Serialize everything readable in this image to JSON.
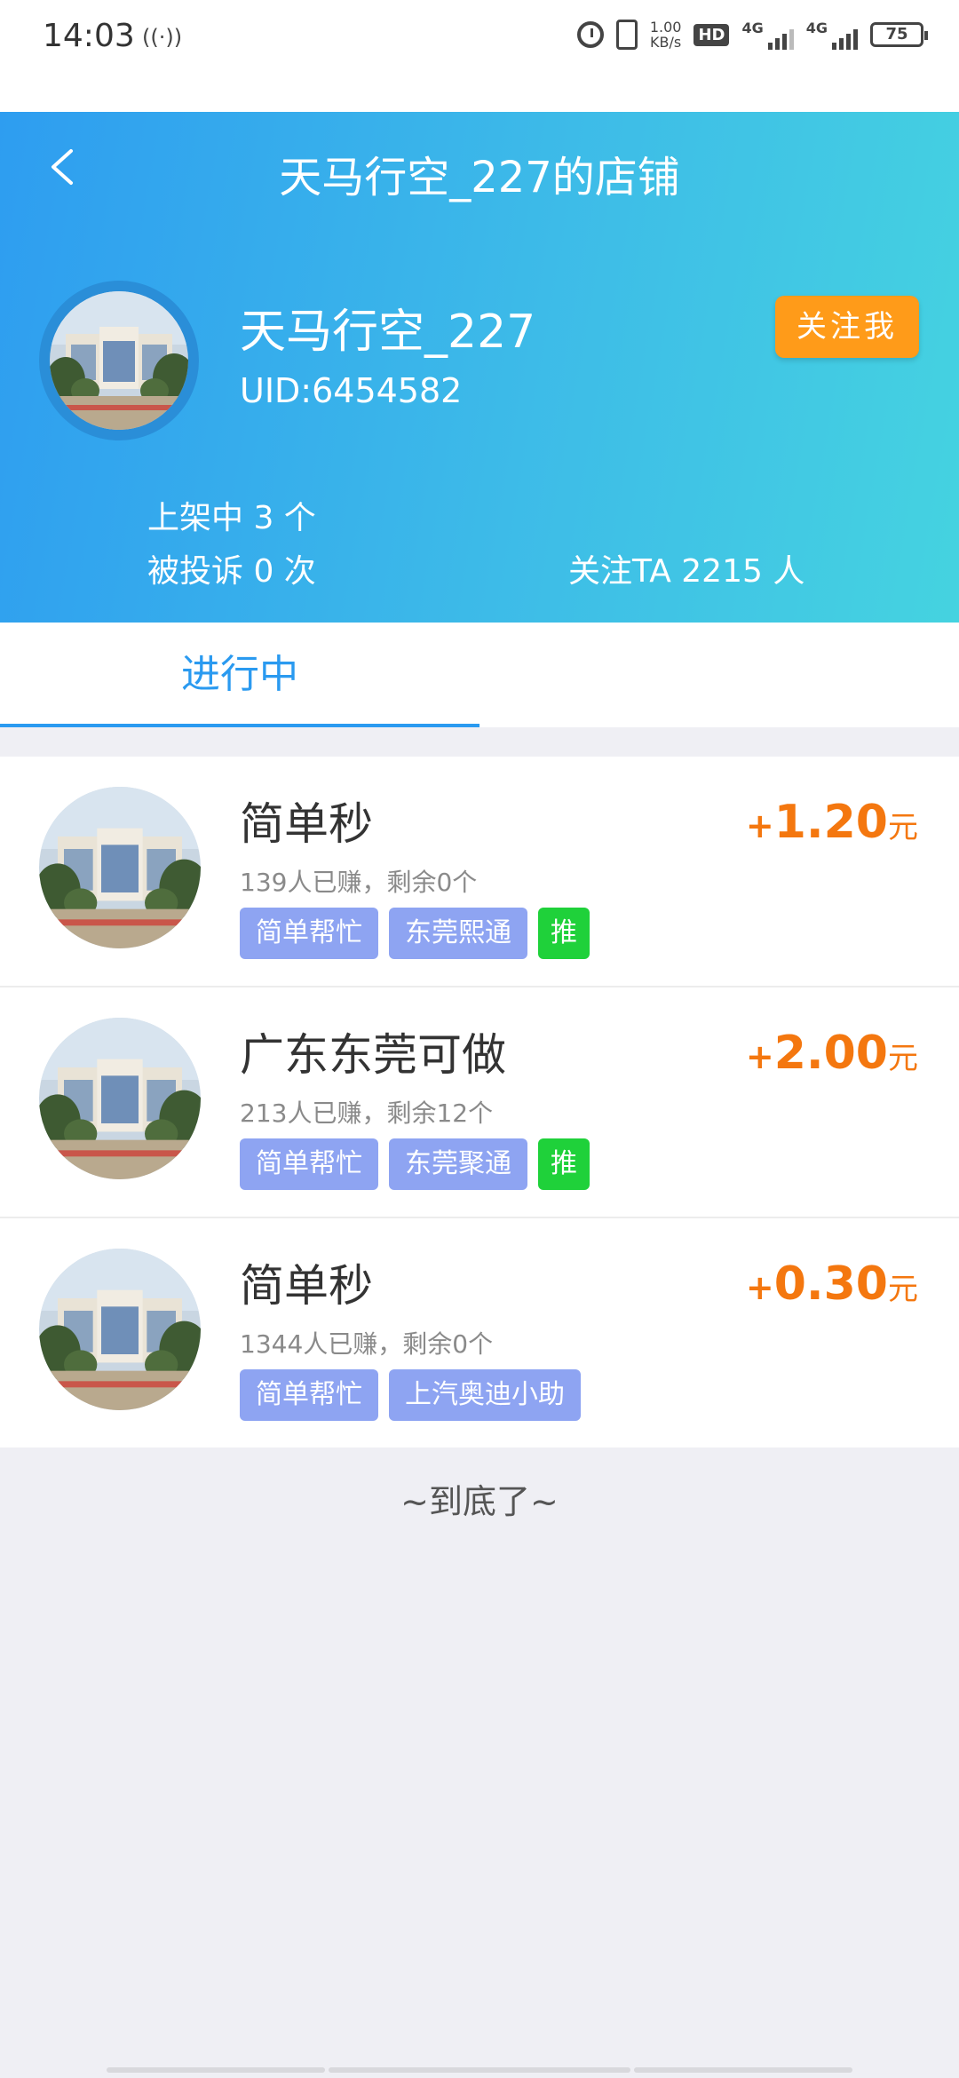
{
  "status_bar": {
    "time": "14:03",
    "hotspot": "((·))",
    "speed_value": "1.00",
    "speed_unit": "KB/s",
    "hd": "HD",
    "net1": "4G",
    "net2": "4G",
    "battery": "75"
  },
  "header": {
    "title": "天马行空_227的店铺",
    "shop_name": "天马行空_227",
    "uid": "UID:6454582",
    "follow_label": "关注我",
    "listed": "上架中 3 个",
    "complaints": "被投诉 0 次",
    "followers": "关注TA 2215 人",
    "gradient_start": "#2e9df0",
    "gradient_end": "#45d3e0"
  },
  "tabs": {
    "active_label": "进行中"
  },
  "items": [
    {
      "title": "简单秒",
      "sub": "139人已赚，剩余0个",
      "tags": [
        "简单帮忙",
        "东莞熙通"
      ],
      "promo": "推",
      "price_plus": "+",
      "price": "1.20",
      "unit": "元"
    },
    {
      "title": "广东东莞可做",
      "sub": "213人已赚，剩余12个",
      "tags": [
        "简单帮忙",
        "东莞聚通"
      ],
      "promo": "推",
      "price_plus": "+",
      "price": "2.00",
      "unit": "元"
    },
    {
      "title": "简单秒",
      "sub": "1344人已赚，剩余0个",
      "tags": [
        "简单帮忙",
        "上汽奥迪小助"
      ],
      "price_plus": "+",
      "price": "0.30",
      "unit": "元"
    }
  ],
  "footer": {
    "end_text": "~到底了~"
  },
  "colors": {
    "accent": "#2a9af0",
    "price": "#f4770f",
    "follow_button": "#ff9b19",
    "tag": "#8ea4f2",
    "promo_tag": "#1fd13a"
  }
}
